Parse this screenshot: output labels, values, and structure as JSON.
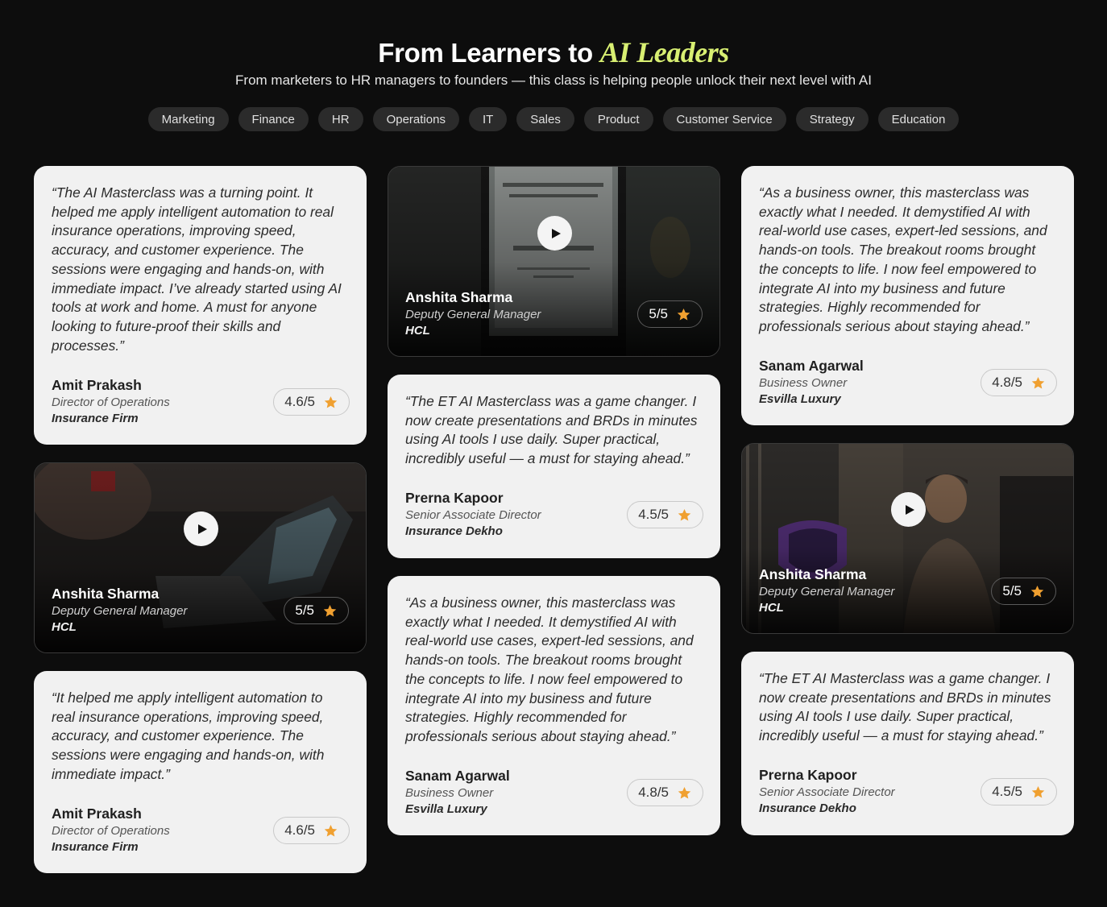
{
  "header": {
    "title_main": "From Learners to",
    "title_accent": "AI Leaders",
    "subtitle": "From marketers to HR managers to founders — this class is helping people unlock their next level with AI"
  },
  "filters": [
    "Marketing",
    "Finance",
    "HR",
    "Operations",
    "IT",
    "Sales",
    "Product",
    "Customer Service",
    "Strategy",
    "Education"
  ],
  "colors": {
    "background": "#0d0d0d",
    "card": "#f1f1f1",
    "accent_title": "#d8ef72",
    "star": "#f0a030"
  },
  "cards": {
    "c1": {
      "quote": "“The AI Masterclass was a turning point. It helped me apply intelligent automation to real insurance operations, improving speed, accuracy, and customer experience. The sessions were engaging and hands-on, with immediate impact. I’ve already started using AI tools at work and home. A must for anyone looking to future-proof their skills and processes.”",
      "name": "Amit Prakash",
      "role": "Director of Operations",
      "company": "Insurance Firm",
      "rating": "4.6/5"
    },
    "c2": {
      "name": "Anshita Sharma",
      "role": "Deputy General Manager",
      "company": "HCL",
      "rating": "5/5",
      "icon": "play-icon"
    },
    "c3": {
      "quote": "“It helped me apply intelligent automation to real insurance operations, improving speed, accuracy, and customer experience. The sessions were engaging and hands-on, with immediate impact.”",
      "name": "Amit Prakash",
      "role": "Director of Operations",
      "company": "Insurance Firm",
      "rating": "4.6/5"
    },
    "c4": {
      "name": "Anshita Sharma",
      "role": "Deputy General Manager",
      "company": "HCL",
      "rating": "5/5",
      "icon": "play-icon"
    },
    "c5": {
      "quote": "“The ET AI Masterclass was a game changer. I now create presentations and BRDs in minutes using AI tools I use daily. Super practical, incredibly useful — a must for staying ahead.”",
      "name": "Prerna Kapoor",
      "role": "Senior Associate Director",
      "company": "Insurance Dekho",
      "rating": "4.5/5"
    },
    "c6": {
      "quote": "“As a business owner, this masterclass was exactly what I needed. It demystified AI with real-world use cases, expert-led sessions, and hands-on tools. The breakout rooms brought the concepts to life. I now feel empowered to integrate AI into my business and future strategies. Highly recommended for professionals serious about staying ahead.”",
      "name": "Sanam Agarwal",
      "role": "Business Owner",
      "company": "Esvilla Luxury",
      "rating": "4.8/5"
    },
    "c7": {
      "quote": "“As a business owner, this masterclass was exactly what I needed. It demystified AI with real-world use cases, expert-led sessions, and hands-on tools. The breakout rooms brought the concepts to life. I now feel empowered to integrate AI into my business and future strategies. Highly recommended for professionals serious about staying ahead.”",
      "name": "Sanam Agarwal",
      "role": "Business Owner",
      "company": "Esvilla Luxury",
      "rating": "4.8/5"
    },
    "c8": {
      "name": "Anshita Sharma",
      "role": "Deputy General Manager",
      "company": "HCL",
      "rating": "5/5",
      "icon": "play-icon"
    },
    "c9": {
      "quote": "“The ET AI Masterclass was a game changer. I now create presentations and BRDs in minutes using AI tools I use daily. Super practical, incredibly useful — a must for staying ahead.”",
      "name": "Prerna Kapoor",
      "role": "Senior Associate Director",
      "company": "Insurance Dekho",
      "rating": "4.5/5"
    }
  }
}
